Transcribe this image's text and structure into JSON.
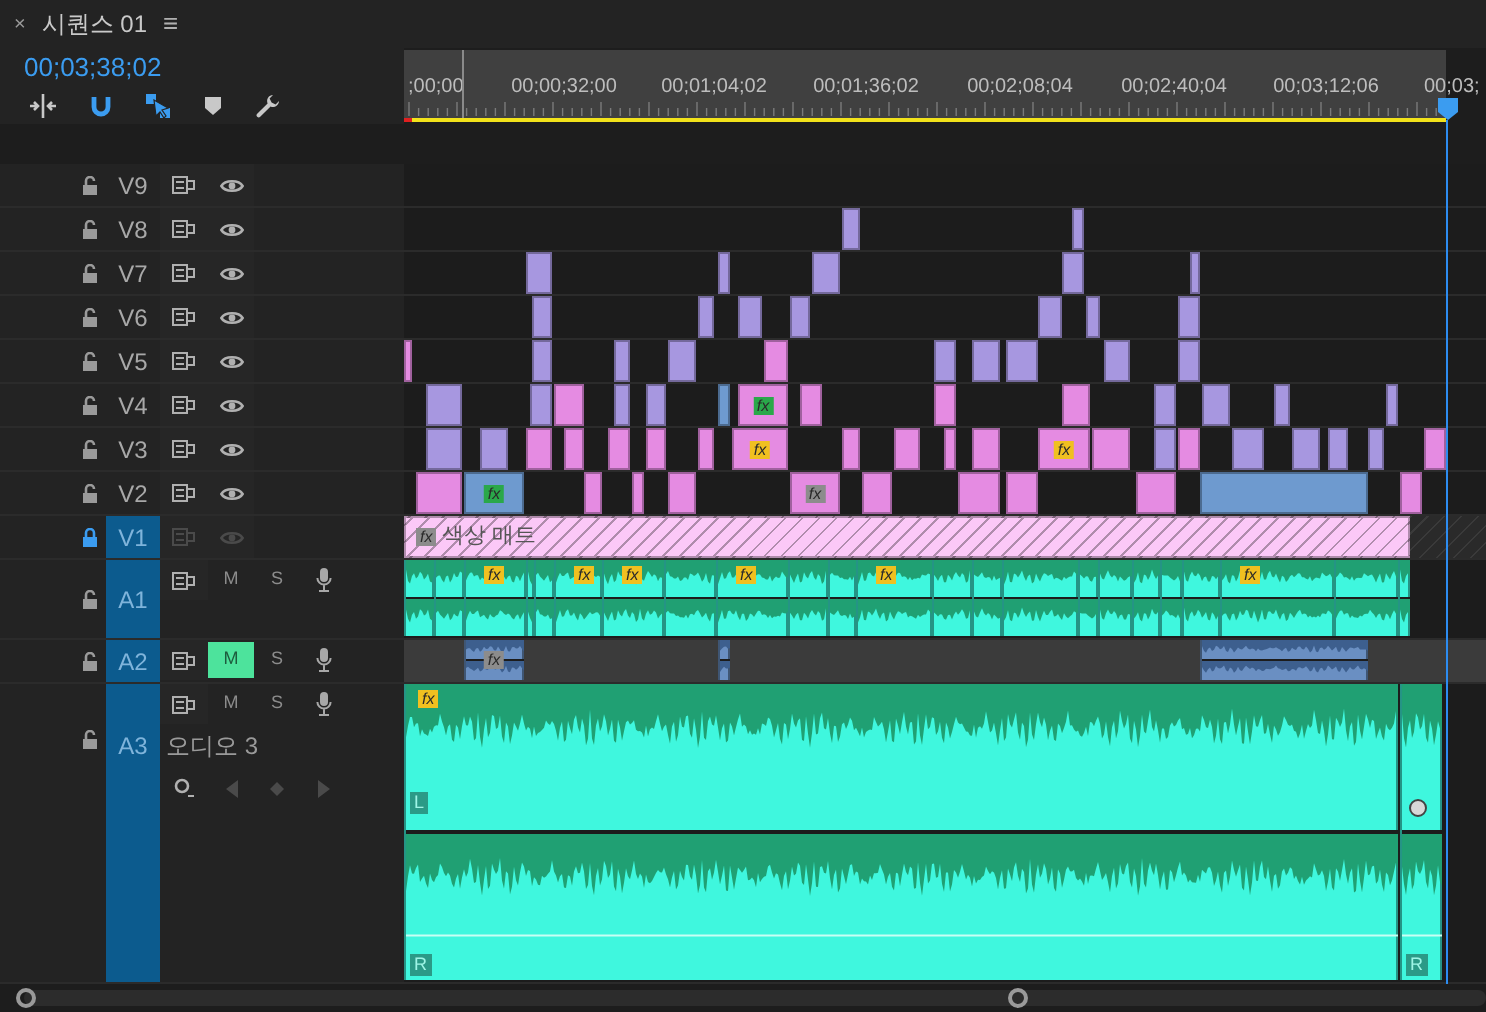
{
  "panel": {
    "close": "×",
    "title": "시퀀스 01",
    "menu": "≡"
  },
  "timecode": "00;03;38;02",
  "toolbar": [
    {
      "kind": "insert",
      "on": false
    },
    {
      "kind": "snap",
      "on": true
    },
    {
      "kind": "linked",
      "on": true
    },
    {
      "kind": "marker",
      "on": false
    },
    {
      "kind": "settings",
      "on": false
    }
  ],
  "ruler": {
    "labels": [
      ";00;00",
      "00;00;32;00",
      "00;01;04;02",
      "00;01;36;02",
      "00;02;08;04",
      "00;02;40;04",
      "00;03;12;06",
      "00;03;"
    ]
  },
  "video_tracks": [
    {
      "label": "V9",
      "targeted": false,
      "locked": false
    },
    {
      "label": "V8",
      "targeted": false,
      "locked": false,
      "clips": [
        {
          "color": "#a797e0"
        },
        {
          "color": "#a797e0"
        }
      ]
    },
    {
      "label": "V7",
      "targeted": false,
      "locked": false,
      "clips": [
        {
          "color": "#a797e0"
        },
        {
          "color": "#a797e0"
        },
        {
          "color": "#a797e0"
        },
        {
          "color": "#a797e0"
        },
        {
          "color": "#a797e0"
        }
      ]
    },
    {
      "label": "V6",
      "targeted": false,
      "locked": false,
      "clips": [
        {
          "color": "#a797e0"
        },
        {
          "color": "#a797e0"
        },
        {
          "color": "#a797e0"
        },
        {
          "color": "#a797e0"
        },
        {
          "color": "#a797e0"
        },
        {
          "color": "#a797e0"
        },
        {
          "color": "#a797e0"
        }
      ]
    },
    {
      "label": "V5",
      "targeted": false,
      "locked": false,
      "clips": [
        {
          "color": "#e58be2"
        },
        {
          "color": "#a797e0"
        },
        {
          "color": "#a797e0"
        },
        {
          "color": "#a797e0"
        },
        {
          "color": "#e58be2"
        },
        {
          "color": "#a797e0"
        },
        {
          "color": "#a797e0"
        },
        {
          "color": "#a797e0"
        },
        {
          "color": "#a797e0"
        },
        {
          "color": "#a797e0"
        }
      ]
    },
    {
      "label": "V4",
      "targeted": false,
      "locked": false,
      "clips": [
        {
          "color": "#a797e0"
        },
        {
          "color": "#a797e0"
        },
        {
          "color": "#e58be2"
        },
        {
          "color": "#a797e0"
        },
        {
          "color": "#a797e0"
        },
        {
          "color": "#6e9acf"
        },
        {
          "color": "#e58be2",
          "badge": {
            "text": "fx",
            "color": "#2aa84a"
          }
        },
        {
          "color": "#e58be2"
        },
        {
          "color": "#e58be2"
        },
        {
          "color": "#e58be2"
        },
        {
          "color": "#a797e0"
        },
        {
          "color": "#a797e0"
        },
        {
          "color": "#a797e0"
        },
        {
          "color": "#a797e0"
        }
      ]
    },
    {
      "label": "V3",
      "targeted": false,
      "locked": false,
      "clips": [
        {
          "color": "#a797e0"
        },
        {
          "color": "#a797e0"
        },
        {
          "color": "#e58be2"
        },
        {
          "color": "#e58be2"
        },
        {
          "color": "#e58be2"
        },
        {
          "color": "#e58be2"
        },
        {
          "color": "#e58be2"
        },
        {
          "color": "#e58be2",
          "badge": {
            "text": "fx",
            "color": "#f0c020"
          }
        },
        {
          "color": "#e58be2"
        },
        {
          "color": "#e58be2"
        },
        {
          "color": "#e58be2"
        },
        {
          "color": "#e58be2"
        },
        {
          "color": "#e58be2",
          "badge": {
            "text": "fx",
            "color": "#f0c020"
          }
        },
        {
          "color": "#e58be2"
        },
        {
          "color": "#a797e0"
        },
        {
          "color": "#e58be2"
        },
        {
          "color": "#a797e0"
        },
        {
          "color": "#a797e0"
        },
        {
          "color": "#a797e0"
        },
        {
          "color": "#a797e0"
        },
        {
          "color": "#e58be2"
        }
      ]
    },
    {
      "label": "V2",
      "targeted": false,
      "locked": false,
      "clips": [
        {
          "color": "#e58be2"
        },
        {
          "color": "#6e9acf",
          "badge": {
            "text": "fx",
            "color": "#2aa84a"
          }
        },
        {
          "color": "#e58be2"
        },
        {
          "color": "#e58be2"
        },
        {
          "color": "#e58be2"
        },
        {
          "color": "#e58be2",
          "badge": {
            "text": "fx",
            "color": "#8c8c8c"
          }
        },
        {
          "color": "#e58be2"
        },
        {
          "color": "#e58be2"
        },
        {
          "color": "#e58be2"
        },
        {
          "color": "#e58be2"
        },
        {
          "color": "#6e9acf"
        },
        {
          "color": "#e58be2"
        }
      ]
    },
    {
      "label": "V1",
      "targeted": true,
      "locked": true,
      "clips": [
        {
          "color": "#fbc8f7",
          "label": "색상 매트",
          "badge": {
            "text": "fx",
            "color": "#8c8c8c"
          }
        }
      ]
    }
  ],
  "audio_tracks": [
    {
      "label": "A1",
      "targeted": true,
      "locked": false,
      "expanded": false,
      "mute": {
        "text": "M",
        "on": false
      },
      "solo": "S",
      "clips": [
        {
          "color": "#3ff7de"
        },
        {
          "color": "#3ff7de"
        },
        {
          "color": "#3ff7de",
          "badge": {
            "text": "fx",
            "color": "#f0c020"
          }
        },
        {
          "color": "#3ff7de"
        },
        {
          "color": "#3ff7de"
        },
        {
          "color": "#3ff7de",
          "badge": {
            "text": "fx",
            "color": "#f0c020"
          }
        },
        {
          "color": "#3ff7de",
          "badge": {
            "text": "fx",
            "color": "#f0c020"
          }
        },
        {
          "color": "#3ff7de"
        },
        {
          "color": "#3ff7de",
          "badge": {
            "text": "fx",
            "color": "#f0c020"
          }
        },
        {
          "color": "#3ff7de"
        },
        {
          "color": "#3ff7de"
        },
        {
          "color": "#3ff7de",
          "badge": {
            "text": "fx",
            "color": "#f0c020"
          }
        },
        {
          "color": "#3ff7de"
        },
        {
          "color": "#3ff7de"
        },
        {
          "color": "#3ff7de"
        },
        {
          "color": "#3ff7de"
        },
        {
          "color": "#3ff7de"
        },
        {
          "color": "#3ff7de"
        },
        {
          "color": "#3ff7de"
        },
        {
          "color": "#3ff7de"
        },
        {
          "color": "#3ff7de",
          "badge": {
            "text": "fx",
            "color": "#f0c020"
          }
        },
        {
          "color": "#3ff7de"
        },
        {
          "color": "#3ff7de"
        }
      ]
    },
    {
      "label": "A2",
      "targeted": true,
      "locked": false,
      "expanded": false,
      "mute": {
        "text": "M",
        "on": true
      },
      "solo": "S",
      "clips": [
        {
          "color": "#6a8fc2",
          "badge": {
            "text": "fx",
            "color": "#8c8c8c"
          }
        },
        {
          "color": "#6a8fc2"
        },
        {
          "color": "#6a8fc2"
        }
      ]
    },
    {
      "label": "A3",
      "targeted": true,
      "locked": false,
      "expanded": true,
      "name": "오디오 3",
      "mute": {
        "text": "M",
        "on": false
      },
      "solo": "S",
      "clips": [
        {
          "color": "#3ff7de",
          "badge": {
            "text": "fx",
            "color": "#f0c020"
          },
          "top_label": "L",
          "bottom_label": "R",
          "keyframe": false
        },
        {
          "color": "#3ff7de",
          "bottom_label": "R",
          "keyframe": true
        }
      ]
    }
  ]
}
